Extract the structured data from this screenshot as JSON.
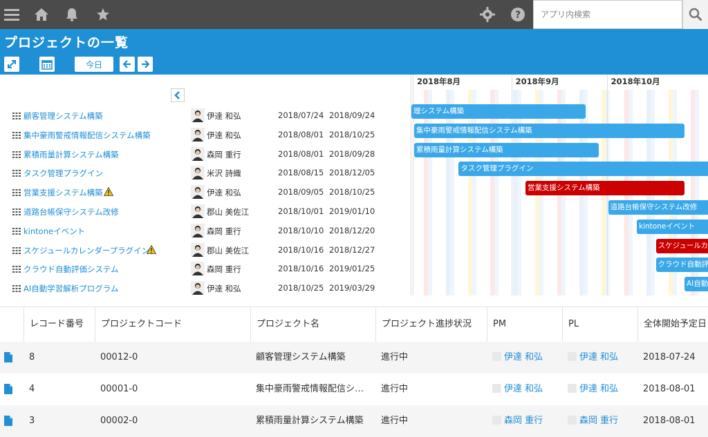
{
  "topbar": {
    "search_placeholder": "アプリ内検索",
    "icons": [
      "menu-icon",
      "home-icon",
      "bell-icon",
      "star-icon",
      "gear-icon",
      "help-icon",
      "search-icon"
    ]
  },
  "header": {
    "title": "プロジェクトの一覧",
    "today_label": "今日"
  },
  "gantt": {
    "months": [
      "2018年8月",
      "2018年9月",
      "2018年10月"
    ],
    "rows": [
      {
        "name": "顧客管理システム構築",
        "person": "伊達 和弘",
        "start": "2018/07/24",
        "end": "2018/09/24",
        "warn": false,
        "bar_label": "理システム構築",
        "bar_color": "#3aa8e8"
      },
      {
        "name": "集中豪雨警戒情報配信システム構築",
        "person": "伊達 和弘",
        "start": "2018/08/01",
        "end": "2018/10/25",
        "warn": false,
        "bar_label": "集中豪雨警戒情報配信システム構築",
        "bar_color": "#3aa8e8"
      },
      {
        "name": "累積雨量計算システム構築",
        "person": "森岡 重行",
        "start": "2018/08/01",
        "end": "2018/09/28",
        "warn": false,
        "bar_label": "累積雨量計算システム構築",
        "bar_color": "#3aa8e8"
      },
      {
        "name": "タスク管理プラグイン",
        "person": "米沢 詩織",
        "start": "2018/08/15",
        "end": "2018/12/05",
        "warn": false,
        "bar_label": "タスク管理プラグイン",
        "bar_color": "#3aa8e8"
      },
      {
        "name": "営業支援システム構築",
        "person": "伊達 和弘",
        "start": "2018/09/05",
        "end": "2018/10/25",
        "warn": true,
        "bar_label": "営業支援システム構築",
        "bar_color": "#cc0000"
      },
      {
        "name": "道路台帳保守システム改修",
        "person": "郡山 美佐江",
        "start": "2018/10/01",
        "end": "2019/01/10",
        "warn": false,
        "bar_label": "道路台帳保守システム改修",
        "bar_color": "#3aa8e8"
      },
      {
        "name": "kintoneイベント",
        "person": "森岡 重行",
        "start": "2018/10/10",
        "end": "2018/12/20",
        "warn": false,
        "bar_label": "kintoneイベント",
        "bar_color": "#3aa8e8"
      },
      {
        "name": "スケジュールカレンダープラグイン",
        "person": "郡山 美佐江",
        "start": "2018/10/16",
        "end": "2018/12/27",
        "warn": true,
        "bar_label": "スケジュールカ",
        "bar_color": "#cc0000"
      },
      {
        "name": "クラウド自動評価システム",
        "person": "森岡 重行",
        "start": "2018/10/16",
        "end": "2019/01/25",
        "warn": false,
        "bar_label": "クラウド自動評",
        "bar_color": "#3aa8e8"
      },
      {
        "name": "AI自動学習解析プログラム",
        "person": "伊達 和弘",
        "start": "2018/10/25",
        "end": "2019/03/29",
        "warn": false,
        "bar_label": "AI自動",
        "bar_color": "#3aa8e8"
      }
    ]
  },
  "table": {
    "headers": [
      "レコード番号",
      "プロジェクトコード",
      "プロジェクト名",
      "プロジェクト進捗状況",
      "PM",
      "PL",
      "全体開始予定日"
    ],
    "rows": [
      {
        "no": "8",
        "code": "00012-0",
        "name": "顧客管理システム構築",
        "status": "進行中",
        "pm": "伊達 和弘",
        "pl": "伊達 和弘",
        "start": "2018-07-24"
      },
      {
        "no": "4",
        "code": "00001-0",
        "name": "集中豪雨警戒情報配信シ…",
        "status": "進行中",
        "pm": "伊達 和弘",
        "pl": "伊達 和弘",
        "start": "2018-08-01"
      },
      {
        "no": "3",
        "code": "00002-0",
        "name": "累積雨量計算システム構築",
        "status": "進行中",
        "pm": "森岡 重行",
        "pl": "森岡 重行",
        "start": "2018-08-01"
      }
    ]
  },
  "colors": {
    "header_blue": "#1f8fd6",
    "bar_blue": "#3aa8e8",
    "bar_red": "#cc0000",
    "topbar": "#4b4b4b"
  }
}
